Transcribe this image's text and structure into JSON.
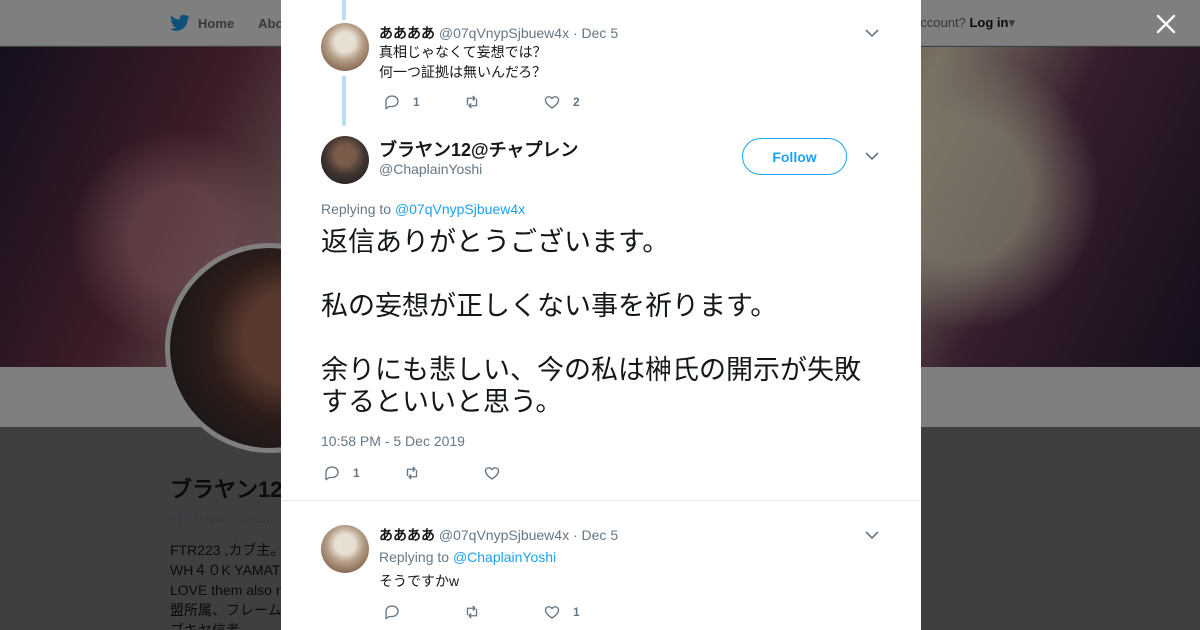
{
  "topbar": {
    "home_label": "Home",
    "about_label": "Abo",
    "account_text": "ccount?",
    "login_label": "Log in"
  },
  "profile": {
    "name": "ブラヤン12",
    "handle": "@ChaplainYoshi",
    "bio": [
      "FTR223 ,カブ主。",
      "WH４０K YAMAT",
      "LOVE them also n",
      "盟所属、フレーム",
      "ブキヤ信者"
    ]
  },
  "thread": {
    "reply1": {
      "name": "ああああ",
      "handle": "@07qVnypSjbuew4x",
      "date": "Dec 5",
      "lines": [
        "真相じゃなくて妄想では？",
        "何一つ証拠は無いんだろ？"
      ],
      "reply_count": "1",
      "retweet_count": "",
      "like_count": "2"
    },
    "main": {
      "name": "ブラヤン12@チャプレン",
      "handle": "@ChaplainYoshi",
      "follow_label": "Follow",
      "replying_prefix": "Replying to",
      "replying_to": "@07qVnypSjbuew4x",
      "paragraphs": [
        "返信ありがとうございます。",
        "私の妄想が正しくない事を祈ります。",
        "余りにも悲しい、今の私は榊氏の開示が失敗するといいと思う。"
      ],
      "timestamp": "10:58 PM - 5 Dec 2019",
      "reply_count": "1",
      "retweet_count": "",
      "like_count": ""
    },
    "reply2": {
      "name": "ああああ",
      "handle": "@07qVnypSjbuew4x",
      "date": "Dec 5",
      "replying_prefix": "Replying to",
      "replying_to": "@ChaplainYoshi",
      "lines": [
        "そうですかw"
      ],
      "reply_count": "",
      "retweet_count": "",
      "like_count": "1"
    }
  },
  "colors": {
    "accent": "#1da1f2",
    "muted": "#657786",
    "text": "#14171a",
    "thread_line": "#b9def5"
  }
}
